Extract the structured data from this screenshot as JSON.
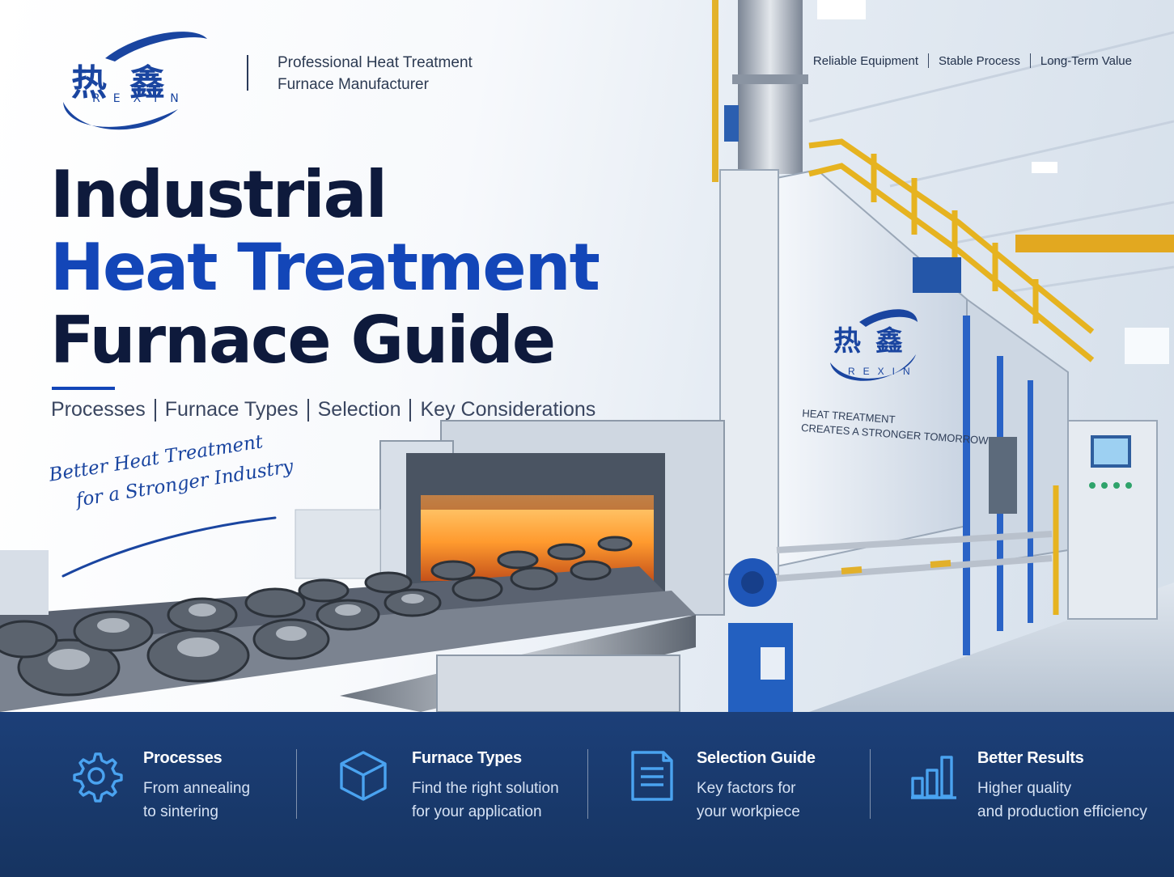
{
  "header": {
    "logo_cn": "热鑫",
    "logo_en": "REXIN",
    "tagline_lines": [
      "Professional Heat Treatment",
      "Furnace Manufacturer"
    ],
    "values": [
      "Reliable Equipment",
      "Stable Process",
      "Long-Term Value"
    ]
  },
  "hero": {
    "title_lines": [
      "Industrial",
      "Heat Treatment",
      "Furnace Guide"
    ],
    "topics": [
      "Processes",
      "Furnace Types",
      "Selection",
      "Key Considerations"
    ],
    "slogan_lines": [
      "Better Heat Treatment",
      "for a Stronger Industry"
    ]
  },
  "furnace": {
    "logo_cn": "热鑫",
    "logo_en": "REXIN",
    "slogan_lines": [
      "Heat Treatment",
      "Creates a Stronger Tomorrow"
    ]
  },
  "features": [
    {
      "icon": "gear-icon",
      "title": "Processes",
      "desc": [
        "From annealing",
        "to sintering"
      ]
    },
    {
      "icon": "cube-icon",
      "title": "Furnace Types",
      "desc": [
        "Find the right solution",
        "for your application"
      ]
    },
    {
      "icon": "document-icon",
      "title": "Selection Guide",
      "desc": [
        "Key factors for",
        "your workpiece"
      ]
    },
    {
      "icon": "bar-chart-icon",
      "title": "Better Results",
      "desc": [
        "Higher quality",
        "and production efficiency"
      ]
    }
  ],
  "colors": {
    "brand_blue": "#1346b8",
    "navy_text": "#0e1a3c",
    "band_background": "#1c3f78",
    "icon_accent": "#4aa3f0"
  }
}
